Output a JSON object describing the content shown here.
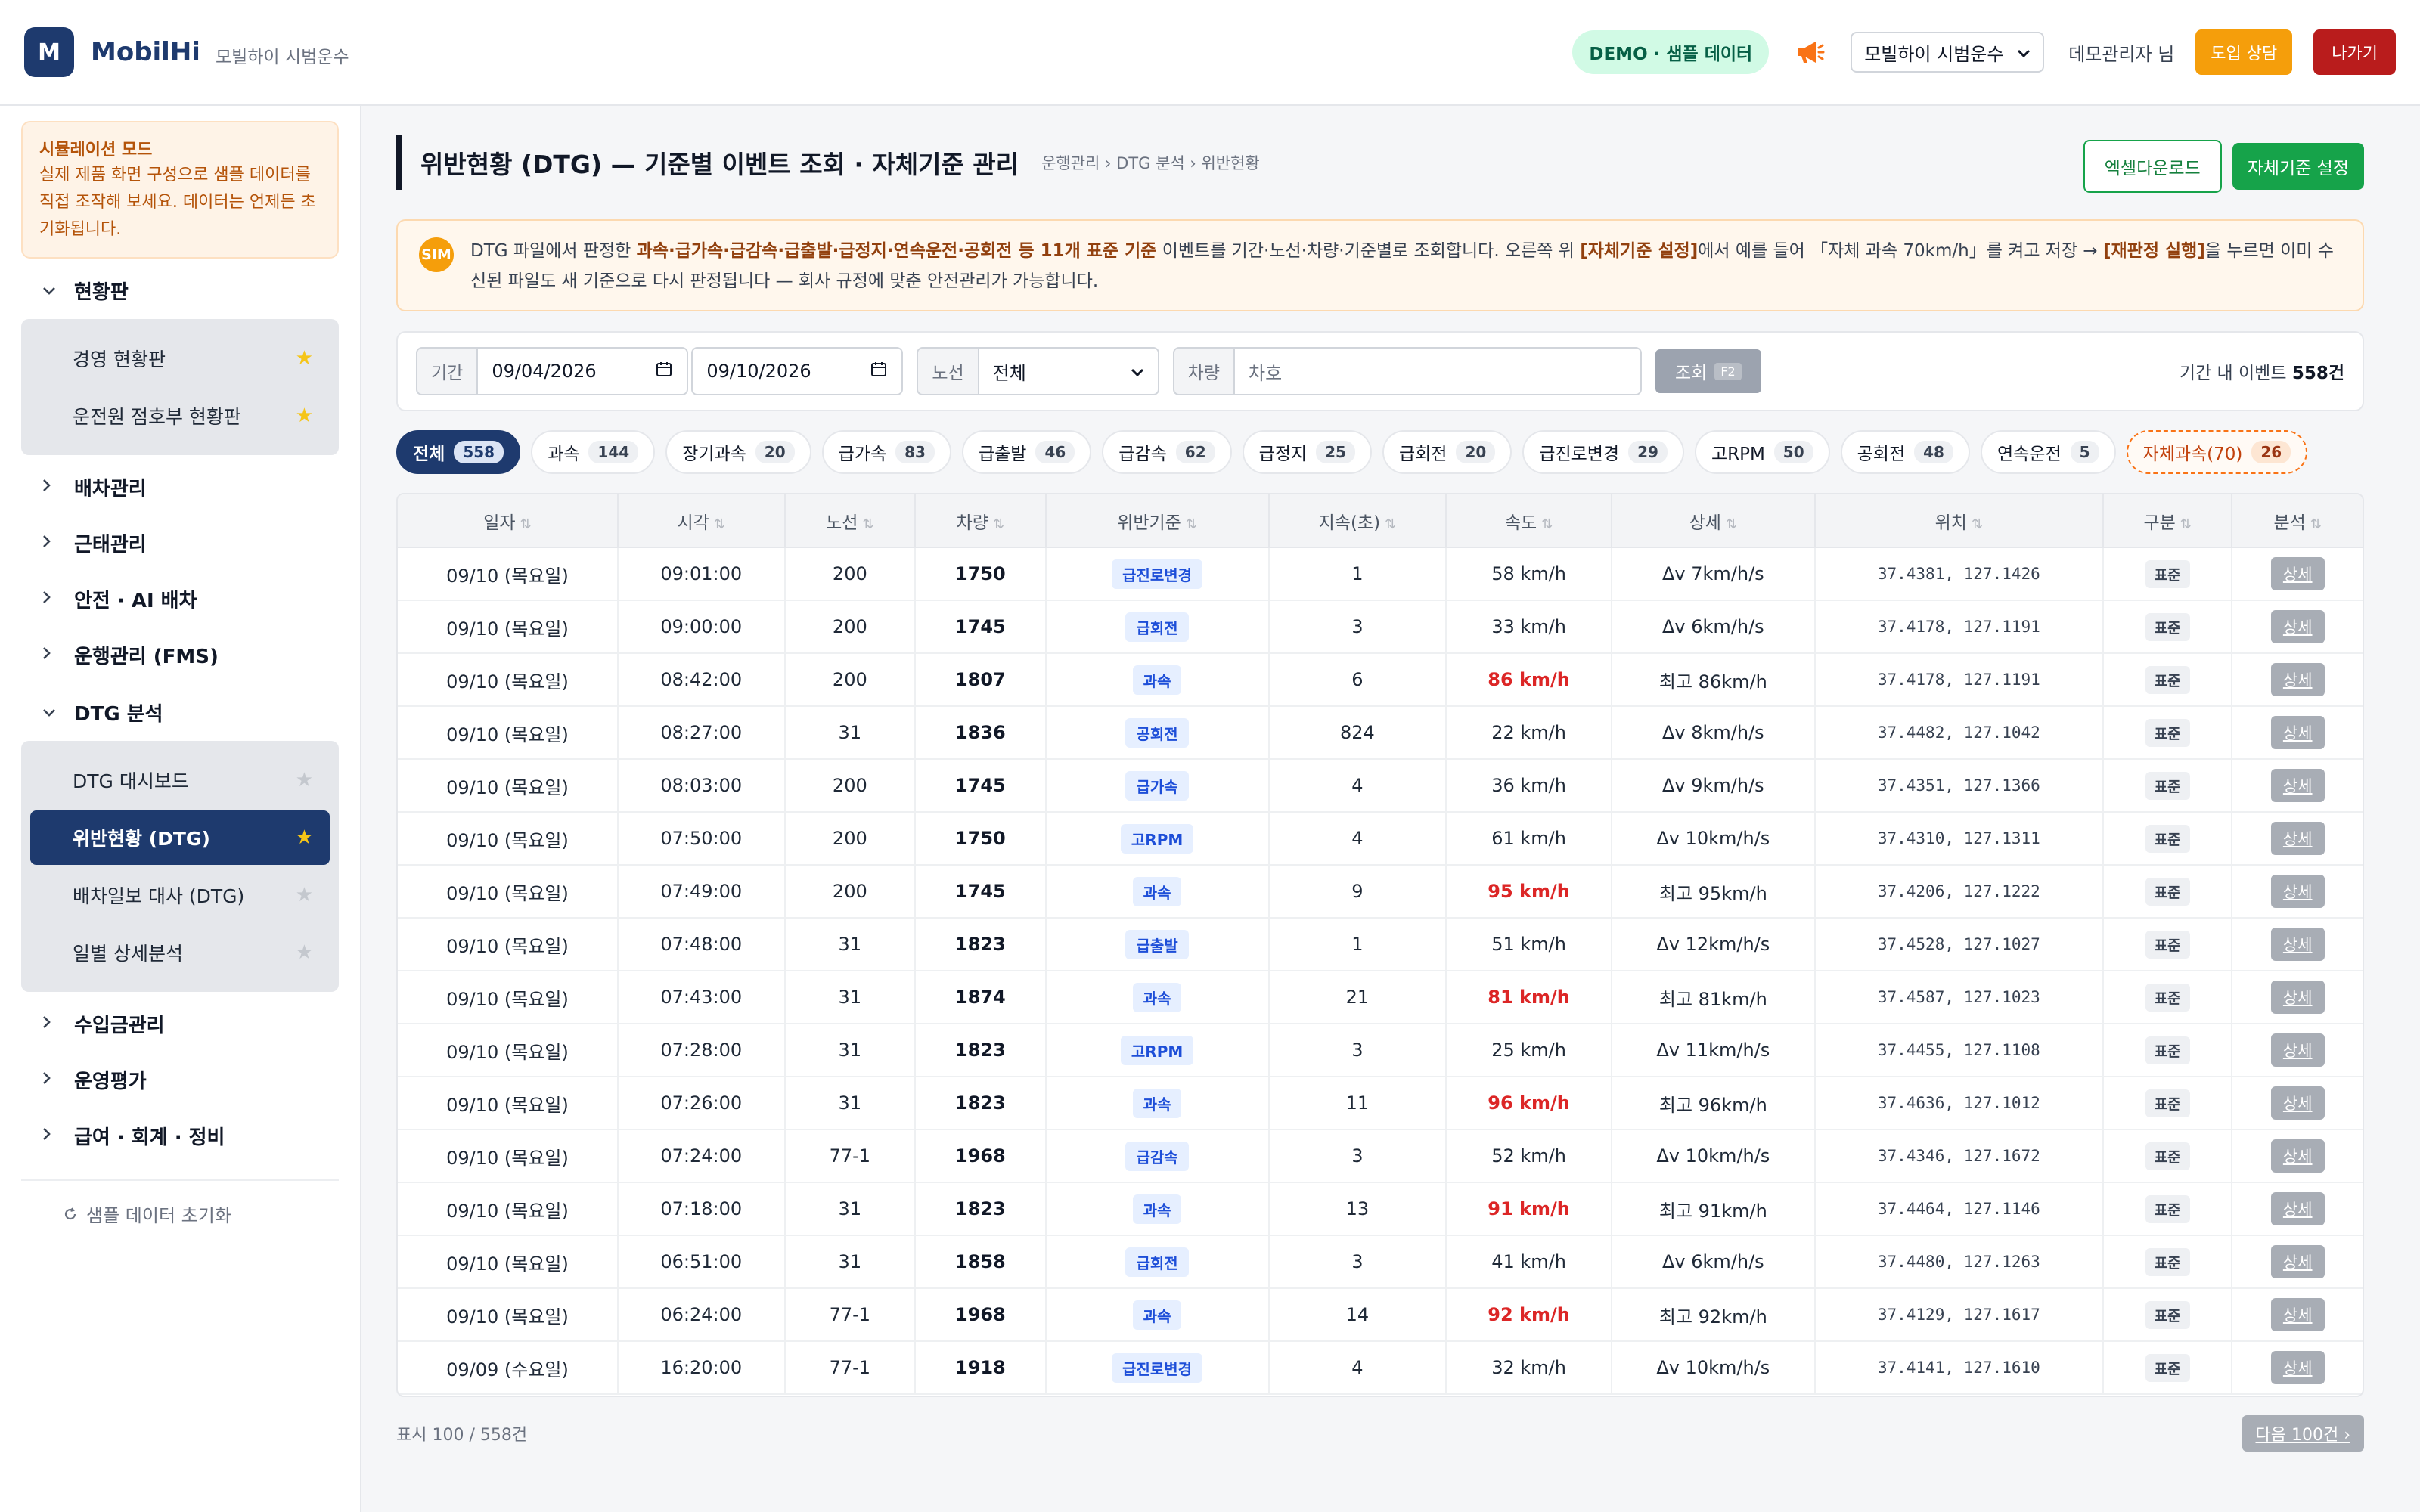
{
  "header": {
    "logo_letter": "M",
    "brand": "MobilHi",
    "brand_sub": "모빌하이 시범운수",
    "demo_badge": "DEMO · 샘플 데이터",
    "company_select": "모빌하이 시범운수",
    "user": "데모관리자 님",
    "consult_button": "도입 상담",
    "exit_button": "나가기"
  },
  "sidebar": {
    "sim_title": "시뮬레이션 모드",
    "sim_text": "실제 제품 화면 구성으로 샘플 데이터를 직접 조작해 보세요. 데이터는 언제든 초기화됩니다.",
    "groups": [
      {
        "label": "현황판",
        "expanded": true,
        "items": [
          {
            "label": "경영 현황판",
            "starred": true,
            "active": false
          },
          {
            "label": "운전원 점호부 현황판",
            "starred": true,
            "active": false
          }
        ]
      },
      {
        "label": "배차관리",
        "expanded": false,
        "items": []
      },
      {
        "label": "근태관리",
        "expanded": false,
        "items": []
      },
      {
        "label": "안전 · AI 배차",
        "expanded": false,
        "items": []
      },
      {
        "label": "운행관리 (FMS)",
        "expanded": false,
        "items": []
      },
      {
        "label": "DTG 분석",
        "expanded": true,
        "items": [
          {
            "label": "DTG 대시보드",
            "starred": false,
            "active": false
          },
          {
            "label": "위반현황 (DTG)",
            "starred": true,
            "active": true
          },
          {
            "label": "배차일보 대사 (DTG)",
            "starred": false,
            "active": false
          },
          {
            "label": "일별 상세분석",
            "starred": false,
            "active": false
          }
        ]
      },
      {
        "label": "수입금관리",
        "expanded": false,
        "items": []
      },
      {
        "label": "운영평가",
        "expanded": false,
        "items": []
      },
      {
        "label": "급여 · 회계 · 정비",
        "expanded": false,
        "items": []
      }
    ],
    "reset_label": "샘플 데이터 초기화"
  },
  "main": {
    "title": "위반현황 (DTG) — 기준별 이벤트 조회 · 자체기준 관리",
    "breadcrumb": "운행관리 › DTG 분석 › 위반현황",
    "excel_button": "엑셀다운로드",
    "self_button": "자체기준 설정",
    "banner": {
      "badge": "SIM",
      "p1": "DTG 파일에서 판정한 ",
      "b1": "과속·급가속·급감속·급출발·급정지·연속운전·공회전 등 11개 표준 기준",
      "p2": " 이벤트를 기간·노선·차량·기준별로 조회합니다. 오른쪽 위 ",
      "b2": "[자체기준 설정]",
      "p3": "에서 예를 들어 「자체 과속 70km/h」를 켜고 저장 → ",
      "b3": "[재판정 실행]",
      "p4": "을 누르면 이미 수신된 파일도 새 기준으로 다시 판정됩니다 — 회사 규정에 맞춘 안전관리가 가능합니다."
    },
    "filter": {
      "period_label": "기간",
      "date_from": "09/04/2026",
      "date_to": "09/10/2026",
      "route_label": "노선",
      "route_value": "전체",
      "vehicle_label": "차량",
      "vehicle_placeholder": "차호",
      "search_button": "조회",
      "search_key": "F2",
      "count_prefix": "기간 내 이벤트 ",
      "count_value": "558건"
    },
    "chips": [
      {
        "label": "전체",
        "count": "558"
      },
      {
        "label": "과속",
        "count": "144"
      },
      {
        "label": "장기과속",
        "count": "20"
      },
      {
        "label": "급가속",
        "count": "83"
      },
      {
        "label": "급출발",
        "count": "46"
      },
      {
        "label": "급감속",
        "count": "62"
      },
      {
        "label": "급정지",
        "count": "25"
      },
      {
        "label": "급회전",
        "count": "20"
      },
      {
        "label": "급진로변경",
        "count": "29"
      },
      {
        "label": "고RPM",
        "count": "50"
      },
      {
        "label": "공회전",
        "count": "48"
      },
      {
        "label": "연속운전",
        "count": "5"
      },
      {
        "label": "자체과속(70)",
        "count": "26"
      }
    ],
    "table": {
      "columns": [
        "일자",
        "시각",
        "노선",
        "차량",
        "위반기준",
        "지속(초)",
        "속도",
        "상세",
        "위치",
        "구분",
        "분석"
      ],
      "detail_label": "상세",
      "rows": [
        {
          "date": "09/10 (목요일)",
          "time": "09:01:00",
          "route": "200",
          "vehicle": "1750",
          "type": "급진로변경",
          "dur": "1",
          "speed": "58 km/h",
          "red": false,
          "detail": "Δv 7km/h/s",
          "loc": "37.4381, 127.1426",
          "kind": "표준"
        },
        {
          "date": "09/10 (목요일)",
          "time": "09:00:00",
          "route": "200",
          "vehicle": "1745",
          "type": "급회전",
          "dur": "3",
          "speed": "33 km/h",
          "red": false,
          "detail": "Δv 6km/h/s",
          "loc": "37.4178, 127.1191",
          "kind": "표준"
        },
        {
          "date": "09/10 (목요일)",
          "time": "08:42:00",
          "route": "200",
          "vehicle": "1807",
          "type": "과속",
          "dur": "6",
          "speed": "86 km/h",
          "red": true,
          "detail": "최고 86km/h",
          "loc": "37.4178, 127.1191",
          "kind": "표준"
        },
        {
          "date": "09/10 (목요일)",
          "time": "08:27:00",
          "route": "31",
          "vehicle": "1836",
          "type": "공회전",
          "dur": "824",
          "speed": "22 km/h",
          "red": false,
          "detail": "Δv 8km/h/s",
          "loc": "37.4482, 127.1042",
          "kind": "표준"
        },
        {
          "date": "09/10 (목요일)",
          "time": "08:03:00",
          "route": "200",
          "vehicle": "1745",
          "type": "급가속",
          "dur": "4",
          "speed": "36 km/h",
          "red": false,
          "detail": "Δv 9km/h/s",
          "loc": "37.4351, 127.1366",
          "kind": "표준"
        },
        {
          "date": "09/10 (목요일)",
          "time": "07:50:00",
          "route": "200",
          "vehicle": "1750",
          "type": "고RPM",
          "dur": "4",
          "speed": "61 km/h",
          "red": false,
          "detail": "Δv 10km/h/s",
          "loc": "37.4310, 127.1311",
          "kind": "표준"
        },
        {
          "date": "09/10 (목요일)",
          "time": "07:49:00",
          "route": "200",
          "vehicle": "1745",
          "type": "과속",
          "dur": "9",
          "speed": "95 km/h",
          "red": true,
          "detail": "최고 95km/h",
          "loc": "37.4206, 127.1222",
          "kind": "표준"
        },
        {
          "date": "09/10 (목요일)",
          "time": "07:48:00",
          "route": "31",
          "vehicle": "1823",
          "type": "급출발",
          "dur": "1",
          "speed": "51 km/h",
          "red": false,
          "detail": "Δv 12km/h/s",
          "loc": "37.4528, 127.1027",
          "kind": "표준"
        },
        {
          "date": "09/10 (목요일)",
          "time": "07:43:00",
          "route": "31",
          "vehicle": "1874",
          "type": "과속",
          "dur": "21",
          "speed": "81 km/h",
          "red": true,
          "detail": "최고 81km/h",
          "loc": "37.4587, 127.1023",
          "kind": "표준"
        },
        {
          "date": "09/10 (목요일)",
          "time": "07:28:00",
          "route": "31",
          "vehicle": "1823",
          "type": "고RPM",
          "dur": "3",
          "speed": "25 km/h",
          "red": false,
          "detail": "Δv 11km/h/s",
          "loc": "37.4455, 127.1108",
          "kind": "표준"
        },
        {
          "date": "09/10 (목요일)",
          "time": "07:26:00",
          "route": "31",
          "vehicle": "1823",
          "type": "과속",
          "dur": "11",
          "speed": "96 km/h",
          "red": true,
          "detail": "최고 96km/h",
          "loc": "37.4636, 127.1012",
          "kind": "표준"
        },
        {
          "date": "09/10 (목요일)",
          "time": "07:24:00",
          "route": "77-1",
          "vehicle": "1968",
          "type": "급감속",
          "dur": "3",
          "speed": "52 km/h",
          "red": false,
          "detail": "Δv 10km/h/s",
          "loc": "37.4346, 127.1672",
          "kind": "표준"
        },
        {
          "date": "09/10 (목요일)",
          "time": "07:18:00",
          "route": "31",
          "vehicle": "1823",
          "type": "과속",
          "dur": "13",
          "speed": "91 km/h",
          "red": true,
          "detail": "최고 91km/h",
          "loc": "37.4464, 127.1146",
          "kind": "표준"
        },
        {
          "date": "09/10 (목요일)",
          "time": "06:51:00",
          "route": "31",
          "vehicle": "1858",
          "type": "급회전",
          "dur": "3",
          "speed": "41 km/h",
          "red": false,
          "detail": "Δv 6km/h/s",
          "loc": "37.4480, 127.1263",
          "kind": "표준"
        },
        {
          "date": "09/10 (목요일)",
          "time": "06:24:00",
          "route": "77-1",
          "vehicle": "1968",
          "type": "과속",
          "dur": "14",
          "speed": "92 km/h",
          "red": true,
          "detail": "최고 92km/h",
          "loc": "37.4129, 127.1617",
          "kind": "표준"
        },
        {
          "date": "09/09 (수요일)",
          "time": "16:20:00",
          "route": "77-1",
          "vehicle": "1918",
          "type": "급진로변경",
          "dur": "4",
          "speed": "32 km/h",
          "red": false,
          "detail": "Δv 10km/h/s",
          "loc": "37.4141, 127.1610",
          "kind": "표준"
        }
      ]
    },
    "footer": {
      "count": "표시 100 / 558건",
      "next_button": "다음 100건 ›"
    }
  },
  "colors": {
    "brand_navy": "#1e3a6e",
    "accent_green": "#16a34a",
    "speed_red": "#dc2626",
    "consult_orange": "#f59e0b",
    "exit_red": "#b91c1c"
  }
}
